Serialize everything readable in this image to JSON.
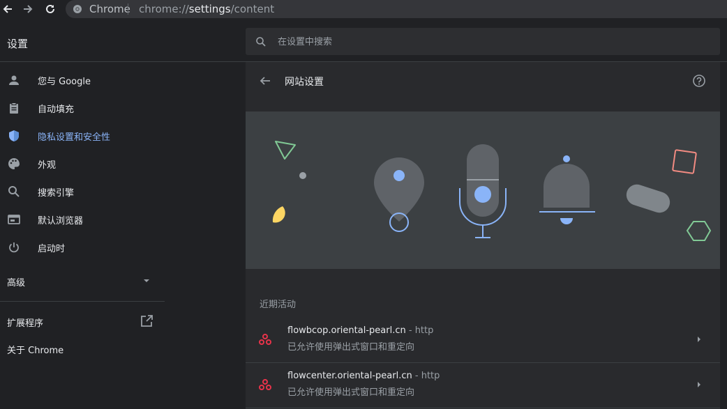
{
  "browser": {
    "omnibox_site": "Chrome",
    "url_prefix": "chrome://",
    "url_bold": "settings",
    "url_suffix": "/content"
  },
  "header": {
    "title": "设置",
    "search_placeholder": "在设置中搜索"
  },
  "sidebar": {
    "items": [
      {
        "label": "您与 Google",
        "icon": "person-icon"
      },
      {
        "label": "自动填充",
        "icon": "clipboard-icon"
      },
      {
        "label": "隐私设置和安全性",
        "icon": "shield-icon",
        "active": true
      },
      {
        "label": "外观",
        "icon": "palette-icon"
      },
      {
        "label": "搜索引擎",
        "icon": "search-icon"
      },
      {
        "label": "默认浏览器",
        "icon": "browser-window-icon"
      },
      {
        "label": "启动时",
        "icon": "power-icon"
      }
    ],
    "advanced_label": "高级",
    "extensions_label": "扩展程序",
    "about_label": "关于 Chrome"
  },
  "main": {
    "title": "网站设置",
    "recent_activity_heading": "近期活动",
    "recent_sites": [
      {
        "host": "flowbcop.oriental-pearl.cn",
        "protocol": "http",
        "description": "已允许使用弹出式窗口和重定向"
      },
      {
        "host": "flowcenter.oriental-pearl.cn",
        "protocol": "http",
        "description": "已允许使用弹出式窗口和重定向"
      }
    ]
  },
  "colors": {
    "accent": "#8ab4f8",
    "background": "#202124",
    "card": "#292a2d",
    "banner": "#3c4043",
    "site_icon": "#e8334a"
  }
}
